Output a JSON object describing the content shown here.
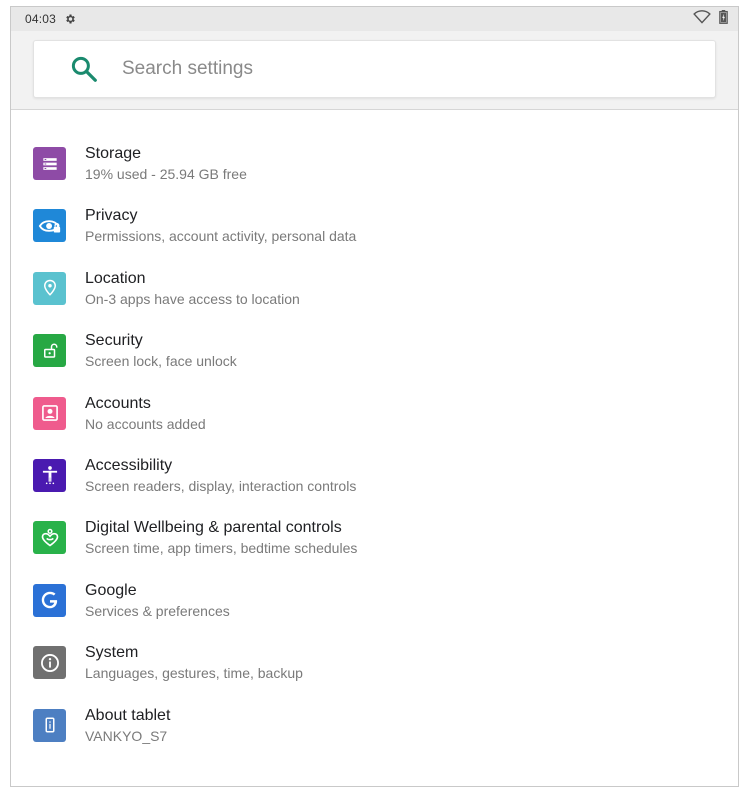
{
  "status_bar": {
    "time": "04:03",
    "icons": [
      "gear-icon",
      "wifi-icon",
      "battery-icon"
    ]
  },
  "search": {
    "placeholder": "Search settings",
    "icon": "search-icon",
    "icon_color": "#1a8a6e"
  },
  "settings_items": [
    {
      "key": "storage",
      "title": "Storage",
      "subtitle": "19% used - 25.94 GB free",
      "icon": "storage-icon",
      "color": "#8e4ba6"
    },
    {
      "key": "privacy",
      "title": "Privacy",
      "subtitle": "Permissions, account activity, personal data",
      "icon": "privacy-eye-icon",
      "color": "#1f88d8"
    },
    {
      "key": "location",
      "title": "Location",
      "subtitle": "On-3 apps have access to location",
      "icon": "location-pin-icon",
      "color": "#5ac2cf"
    },
    {
      "key": "security",
      "title": "Security",
      "subtitle": "Screen lock, face unlock",
      "icon": "lock-icon",
      "color": "#27a844"
    },
    {
      "key": "accounts",
      "title": "Accounts",
      "subtitle": "No accounts added",
      "icon": "account-icon",
      "color": "#ef5b8d"
    },
    {
      "key": "accessibility",
      "title": "Accessibility",
      "subtitle": "Screen readers, display, interaction controls",
      "icon": "accessibility-icon",
      "color": "#4a1ab0"
    },
    {
      "key": "wellbeing",
      "title": "Digital Wellbeing & parental controls",
      "subtitle": "Screen time, app timers, bedtime schedules",
      "icon": "wellbeing-heart-icon",
      "color": "#29b24a"
    },
    {
      "key": "google",
      "title": "Google",
      "subtitle": "Services & preferences",
      "icon": "google-g-icon",
      "color": "#2b71d6"
    },
    {
      "key": "system",
      "title": "System",
      "subtitle": "Languages, gestures, time, backup",
      "icon": "info-icon",
      "color": "#707070"
    },
    {
      "key": "about",
      "title": "About tablet",
      "subtitle": "VANKYO_S7",
      "icon": "tablet-icon",
      "color": "#4d7fc2"
    }
  ]
}
